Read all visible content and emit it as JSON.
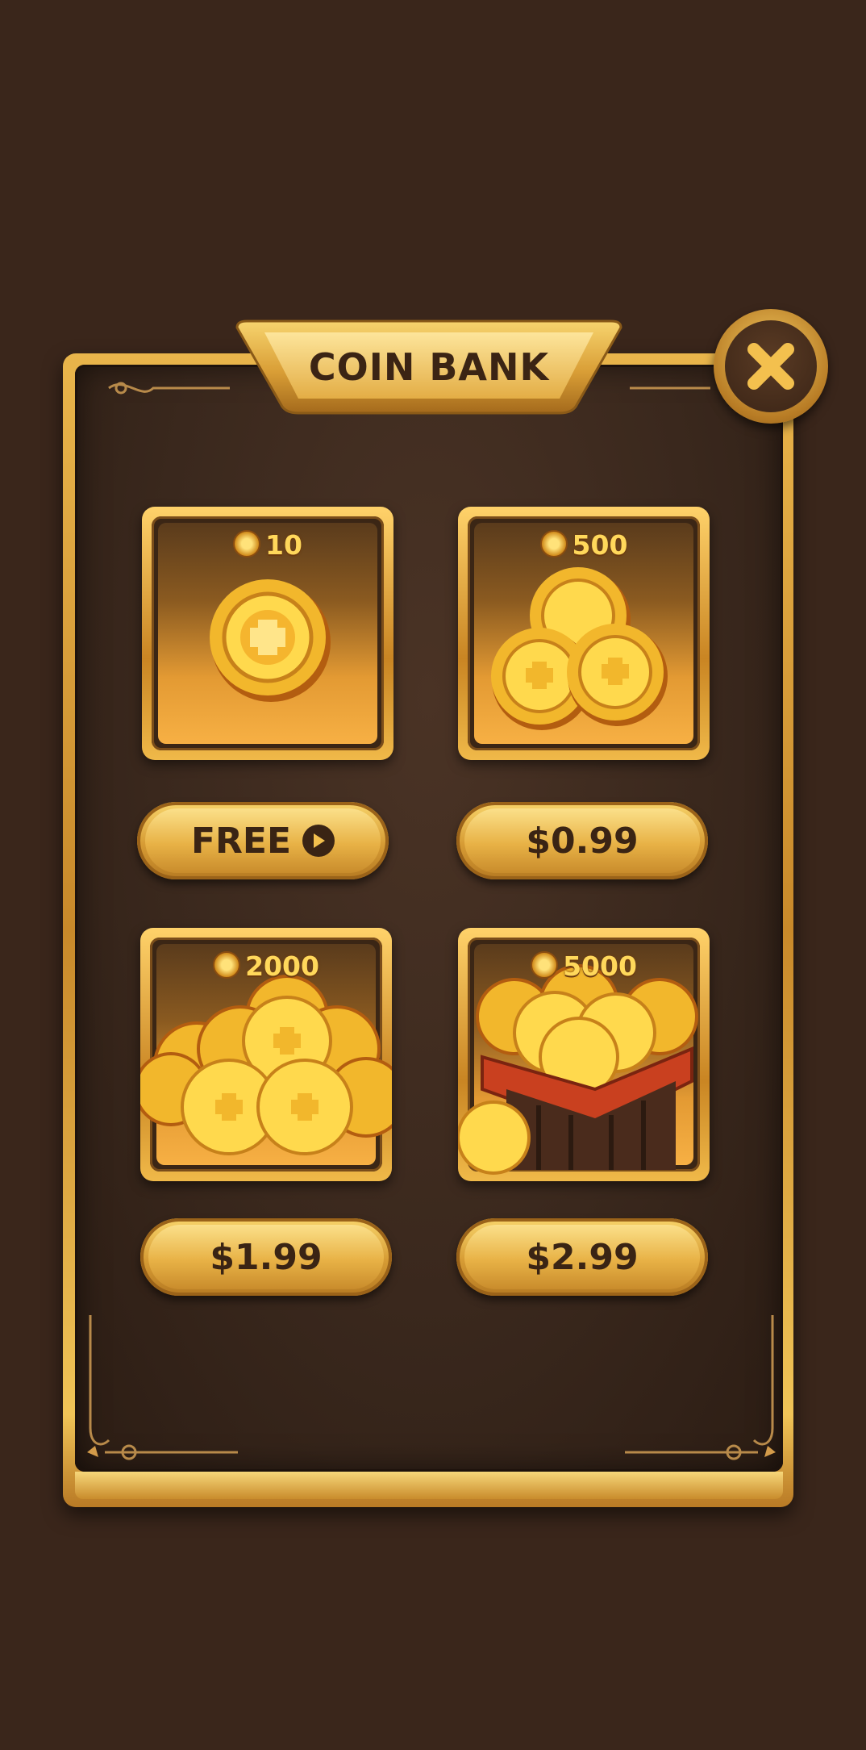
{
  "header": {
    "title": "COIN BANK"
  },
  "close": {
    "label": "close"
  },
  "offers": [
    {
      "amount": "10",
      "price": "FREE",
      "icon": "play-icon"
    },
    {
      "amount": "500",
      "price": "$0.99"
    },
    {
      "amount": "2000",
      "price": "$1.99"
    },
    {
      "amount": "5000",
      "price": "$2.99"
    }
  ],
  "colors": {
    "background": "#3a261b",
    "gold": "#e9b54b",
    "text_dark": "#3b2414",
    "coin": "#ffd85b"
  }
}
